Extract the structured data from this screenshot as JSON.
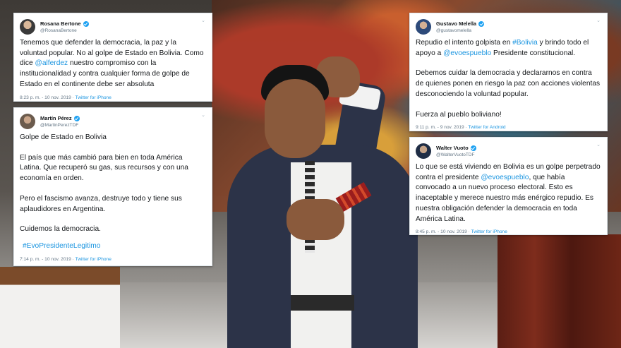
{
  "tweets": {
    "rosana": {
      "name": "Rosana Bertone",
      "handle": "@RosanaBertone",
      "text_1": "Tenemos que defender la democracia, la paz y la voluntad popular. No al golpe de Estado en Bolivia. Como dice ",
      "mention": "@alferdez",
      "text_2": " nuestro compromiso con la institucionalidad y contra cualquier forma de golpe de Estado en el continente debe ser absoluta",
      "time": "8:23 p. m. - 10 nov. 2019",
      "source": "Twitter for iPhone"
    },
    "martin": {
      "name": "Martín Pérez",
      "handle": "@MartinPerezTDF",
      "p1": "Golpe de Estado en Bolivia",
      "p2": "El país que más cambió para bien en toda América Latina. Que recuperó su gas, sus recursos y con una economía en orden.",
      "p3": "Pero el fascismo avanza, destruye todo y tiene sus aplaudidores en Argentina.",
      "p4": "Cuidemos la democracia.",
      "hashtag": "#EvoPresidenteLegitimo",
      "time": "7:14 p. m. - 10 nov. 2019",
      "source": "Twitter for iPhone"
    },
    "gustavo": {
      "name": "Gustavo Melella",
      "handle": "@gustavomelella",
      "p1_a": "Repudio el intento golpista en ",
      "p1_hashtag": "#Bolivia",
      "p1_b": " y brindo todo el apoyo a ",
      "p1_mention": "@evoespueblo",
      "p1_c": " Presidente constitucional.",
      "p2": "Debemos cuidar la democracia y declararnos en contra de quienes ponen en riesgo la paz con acciones violentas desconociendo la voluntad popular.",
      "p3": "Fuerza al pueblo boliviano!",
      "time": "9:11 p. m. - 9 nov. 2019",
      "source": "Twitter for Android"
    },
    "walter": {
      "name": "Walter Vuoto",
      "handle": "@WalterVuotoTDF",
      "text_1": "Lo que se está viviendo en Bolivia es un golpe perpetrado contra el presidente ",
      "mention": "@evoespueblo",
      "text_2": ", que había convocado a un nuevo proceso electoral. Esto es inaceptable y merece nuestro más enérgico repudio. Es nuestra obligación defender la democracia en toda América Latina.",
      "time": "8:45 p. m. - 10 nov. 2019",
      "source": "Twitter for iPhone"
    }
  },
  "icons": {
    "verified": "verified-badge-icon",
    "caret": "chevron-down-icon"
  },
  "colors": {
    "link": "#1b95e0",
    "verified": "#1da1f2",
    "meta": "#657786",
    "text": "#14171a"
  }
}
